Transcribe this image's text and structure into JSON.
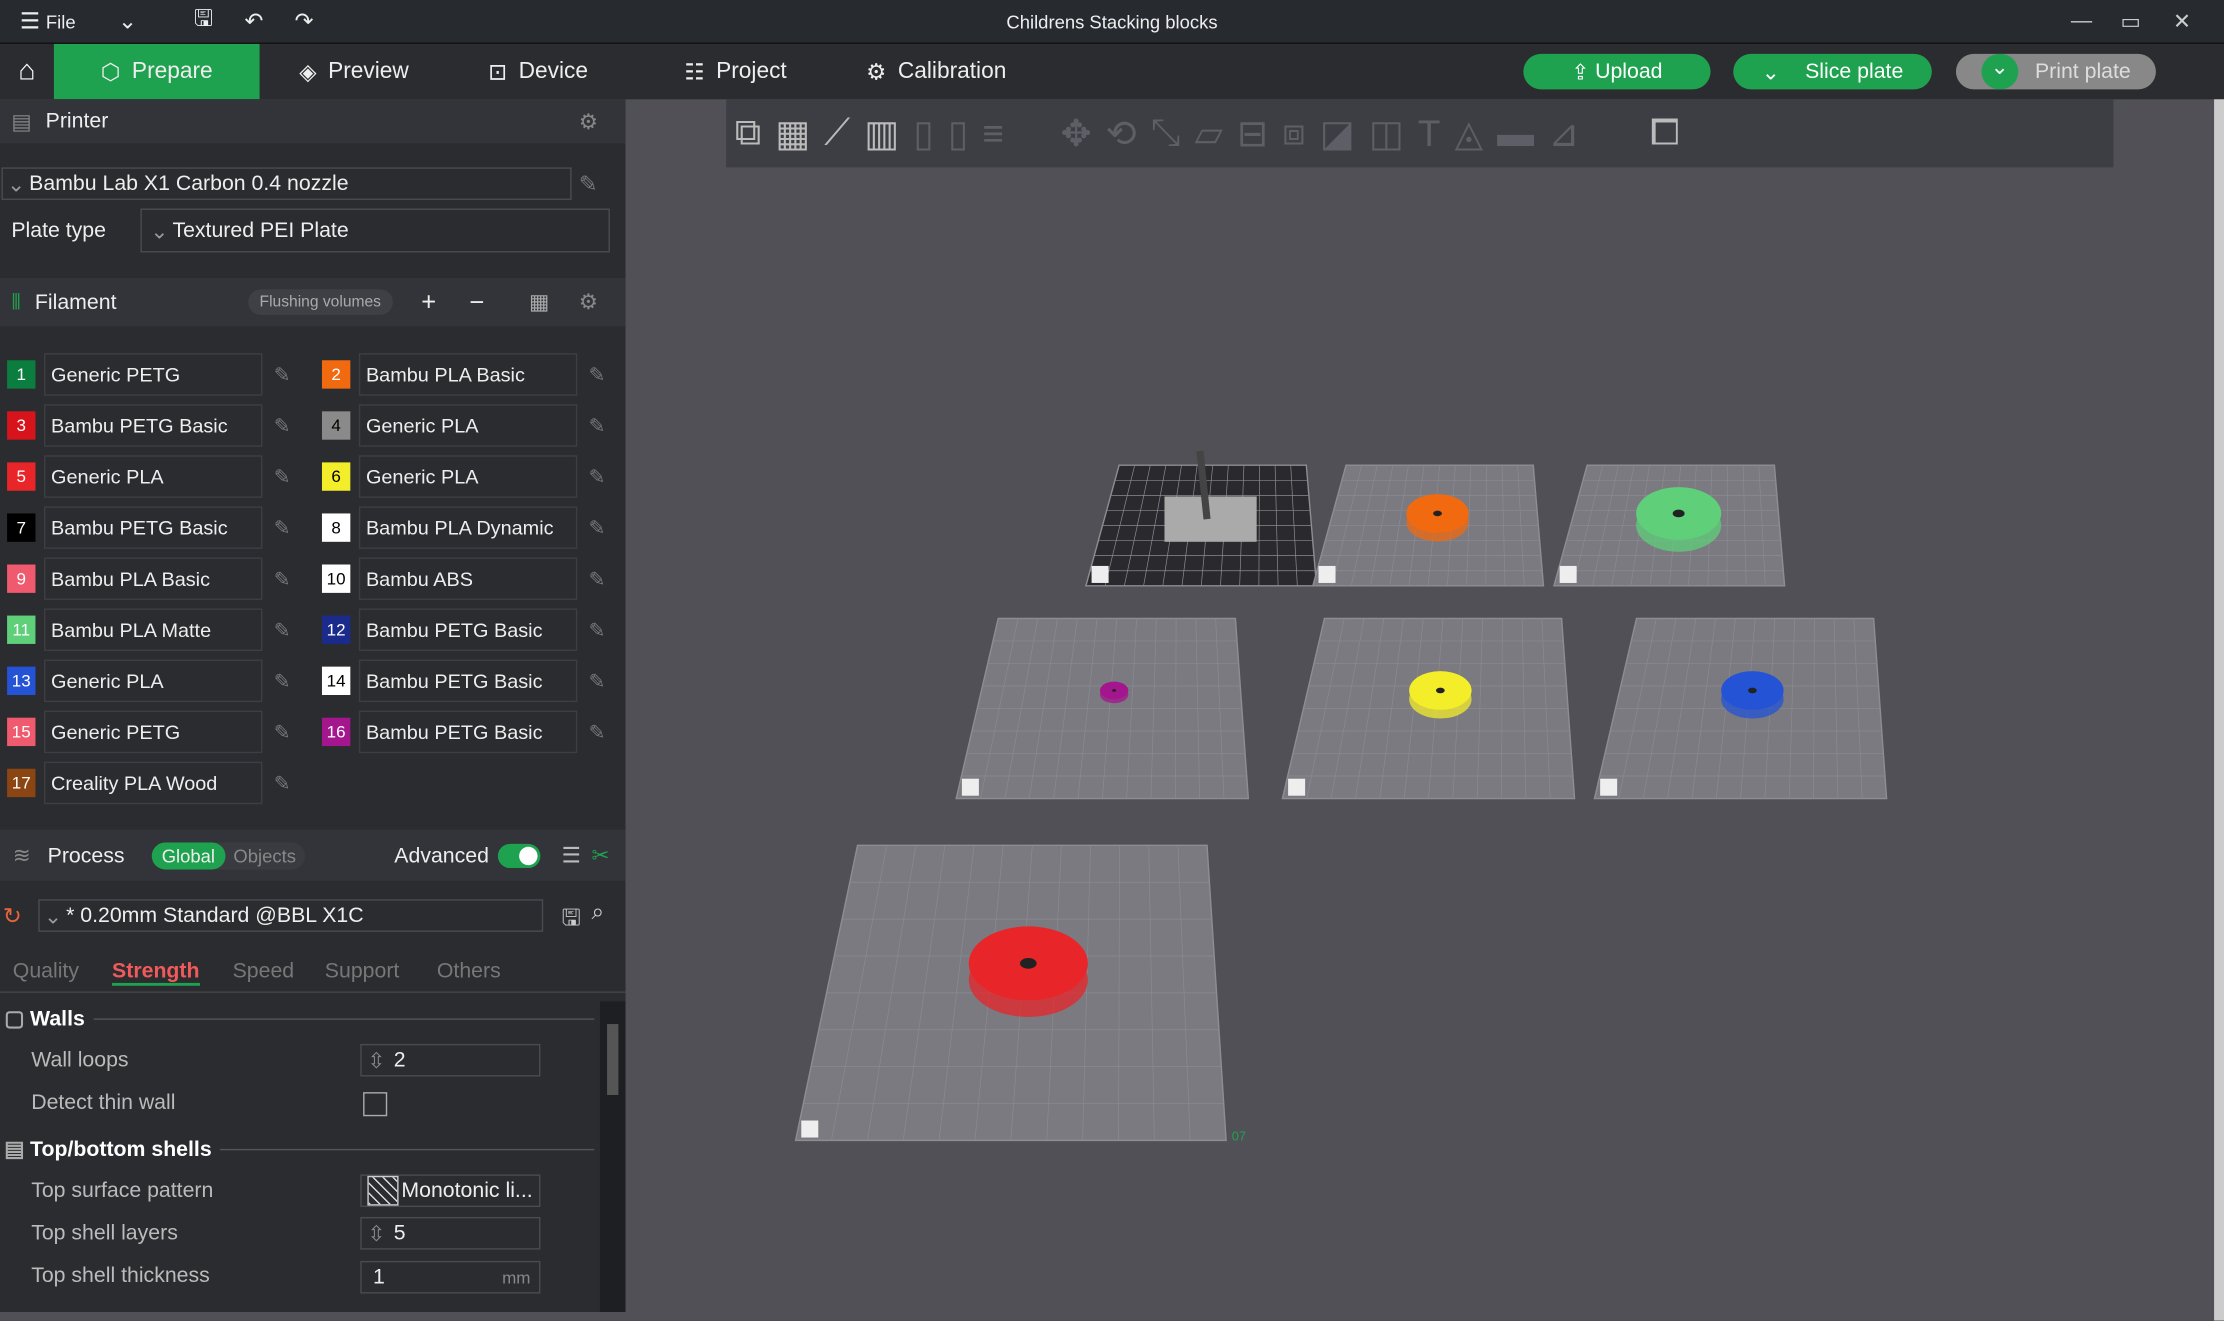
{
  "window": {
    "title": "Childrens Stacking blocks",
    "file_label": "File"
  },
  "nav": {
    "tabs": [
      {
        "label": "Prepare",
        "active": true
      },
      {
        "label": "Preview"
      },
      {
        "label": "Device"
      },
      {
        "label": "Project"
      },
      {
        "label": "Calibration"
      }
    ],
    "upload": "Upload",
    "slice": "Slice plate",
    "print": "Print plate",
    "accent": "#1fa24f"
  },
  "printer": {
    "title": "Printer",
    "name": "Bambu Lab X1 Carbon 0.4 nozzle",
    "plate_label": "Plate type",
    "plate_value": "Textured PEI Plate"
  },
  "filament": {
    "title": "Filament",
    "flushing": "Flushing volumes",
    "items": [
      {
        "n": "1",
        "name": "Generic PETG",
        "color": "#0b7d3f"
      },
      {
        "n": "2",
        "name": "Bambu PLA Basic",
        "color": "#f26a10"
      },
      {
        "n": "3",
        "name": "Bambu PETG Basic",
        "color": "#d7141b"
      },
      {
        "n": "4",
        "name": "Generic PLA",
        "color": "#8a8a8a"
      },
      {
        "n": "5",
        "name": "Generic PLA",
        "color": "#e8262a"
      },
      {
        "n": "6",
        "name": "Generic PLA",
        "color": "#f4ee2a"
      },
      {
        "n": "7",
        "name": "Bambu PETG Basic",
        "color": "#000000"
      },
      {
        "n": "8",
        "name": "Bambu PLA Dynamic",
        "color": "#ffffff"
      },
      {
        "n": "9",
        "name": "Bambu PLA Basic",
        "color": "#ef5a6e"
      },
      {
        "n": "10",
        "name": "Bambu ABS",
        "color": "#ffffff"
      },
      {
        "n": "11",
        "name": "Bambu PLA Matte",
        "color": "#5fcf7a"
      },
      {
        "n": "12",
        "name": "Bambu PETG Basic",
        "color": "#1a2b8c"
      },
      {
        "n": "13",
        "name": "Generic PLA",
        "color": "#2453d6"
      },
      {
        "n": "14",
        "name": "Bambu PETG Basic",
        "color": "#ffffff"
      },
      {
        "n": "15",
        "name": "Generic PETG",
        "color": "#ef5a6e"
      },
      {
        "n": "16",
        "name": "Bambu PETG Basic",
        "color": "#a3168e"
      },
      {
        "n": "17",
        "name": "Creality PLA Wood",
        "color": "#8b4513"
      }
    ]
  },
  "process": {
    "title": "Process",
    "global": "Global",
    "objects": "Objects",
    "advanced": "Advanced",
    "advanced_on": true,
    "preset": "* 0.20mm Standard @BBL X1C",
    "tabs": [
      "Quality",
      "Strength",
      "Speed",
      "Support",
      "Others"
    ],
    "active_tab": "Strength",
    "walls": {
      "title": "Walls",
      "wall_loops_label": "Wall loops",
      "wall_loops": "2",
      "thin_wall_label": "Detect thin wall",
      "thin_wall": false
    },
    "shells": {
      "title": "Top/bottom shells",
      "pattern_label": "Top surface pattern",
      "pattern": "Monotonic li...",
      "layers_label": "Top shell layers",
      "layers": "5",
      "thickness_label": "Top shell thickness",
      "thickness": "1",
      "unit": "mm"
    }
  },
  "plates": [
    {
      "label": "",
      "color": "#999999"
    },
    {
      "label": "",
      "color": "#f26a10"
    },
    {
      "label": "",
      "color": "#5fcf7a"
    },
    {
      "label": "",
      "color": "#a3168e"
    },
    {
      "label": "",
      "color": "#f4ee2a"
    },
    {
      "label": "",
      "color": "#2453d6"
    },
    {
      "label": "07",
      "color": "#e8262a"
    }
  ]
}
